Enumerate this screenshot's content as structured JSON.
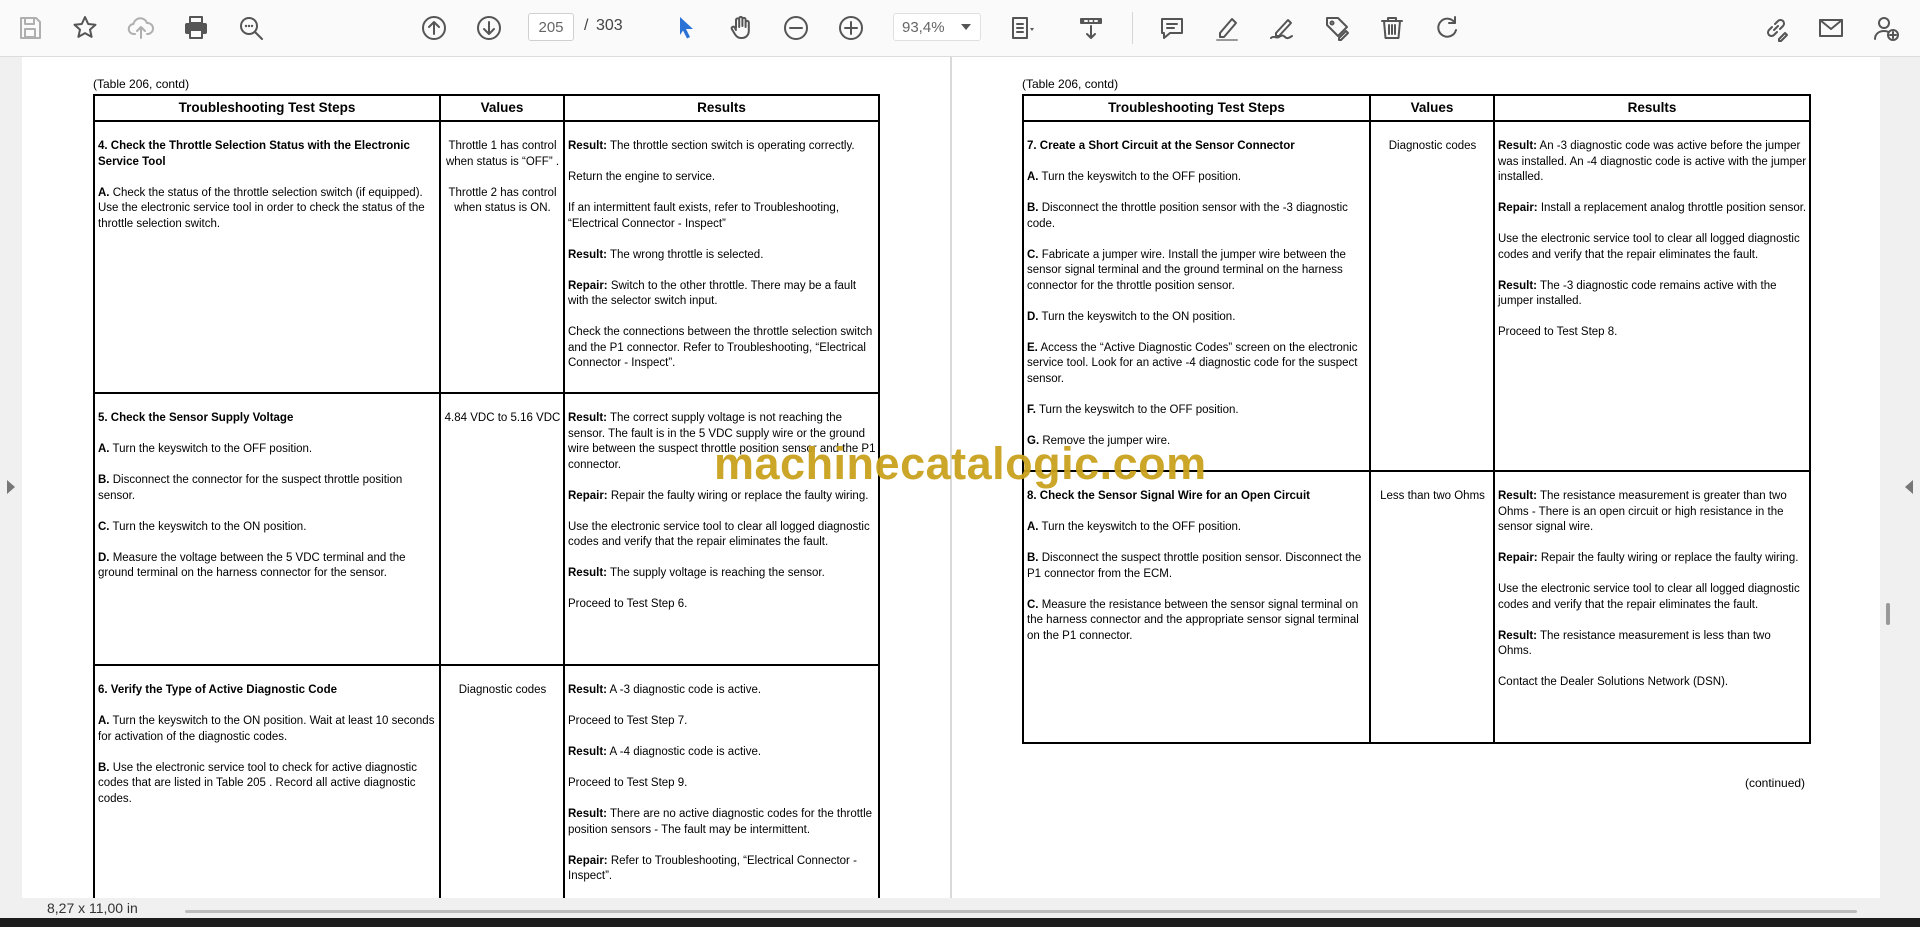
{
  "toolbar": {
    "current_page": "205",
    "page_separator": "/",
    "total_pages": "303",
    "zoom": "93,4%"
  },
  "left_page": {
    "caption": "(Table 206, contd)",
    "headers": [
      "Troubleshooting Test Steps",
      "Values",
      "Results"
    ],
    "rows": [
      {
        "title": "4. Check the Throttle Selection Status with the Electronic Service Tool",
        "steps": [
          {
            "letter": "A.",
            "text": "Check the status of the throttle selection switch (if equipped). Use the electronic service tool in order to check the status of the throttle selection switch."
          }
        ],
        "values": [
          "Throttle 1 has control when status is “OFF” .",
          "Throttle 2 has control when status is ON."
        ],
        "results": [
          {
            "label": "Result:",
            "text": "The throttle section switch is operating correctly."
          },
          {
            "label": "",
            "text": "Return the engine to service."
          },
          {
            "label": "",
            "text": "If an intermittent fault exists, refer to Troubleshooting, “Electrical Connector - Inspect”"
          },
          {
            "label": "Result:",
            "text": "The wrong throttle is selected."
          },
          {
            "label": "Repair:",
            "text": "Switch to the other throttle. There may be a fault with the selector switch input."
          },
          {
            "label": "",
            "text": "Check the connections between the throttle selection switch and the P1 connector. Refer to Troubleshooting, “Electrical Connector - Inspect”."
          }
        ]
      },
      {
        "title": "5. Check the Sensor Supply Voltage",
        "steps": [
          {
            "letter": "A.",
            "text": "Turn the keyswitch to the OFF position."
          },
          {
            "letter": "B.",
            "text": "Disconnect the connector for the suspect throttle position sensor."
          },
          {
            "letter": "C.",
            "text": "Turn the keyswitch to the ON position."
          },
          {
            "letter": "D.",
            "text": "Measure the voltage between the 5 VDC terminal and the ground terminal on the harness connector for the sensor."
          }
        ],
        "values": [
          "4.84 VDC to 5.16 VDC"
        ],
        "results": [
          {
            "label": "Result:",
            "text": "The correct supply voltage is not reaching the sensor. The fault is in the 5 VDC supply wire or the ground wire between the suspect throttle position sensor and the P1 connector."
          },
          {
            "label": "Repair:",
            "text": "Repair the faulty wiring or replace the faulty wiring."
          },
          {
            "label": "",
            "text": "Use the electronic service tool to clear all logged diagnostic codes and verify that the repair eliminates the fault."
          },
          {
            "label": "Result:",
            "text": "The supply voltage is reaching the sensor."
          },
          {
            "label": "",
            "text": "Proceed to Test Step 6."
          }
        ]
      },
      {
        "title": "6. Verify the Type of Active Diagnostic Code",
        "steps": [
          {
            "letter": "A.",
            "text": "Turn the keyswitch to the ON position. Wait at least 10 seconds for activation of the diagnostic codes."
          },
          {
            "letter": "B.",
            "text": "Use the electronic service tool to check for active diagnostic codes that are listed in Table 205 . Record all active diagnostic codes."
          }
        ],
        "values": [
          "Diagnostic codes"
        ],
        "results": [
          {
            "label": "Result:",
            "text": "A -3 diagnostic code is active."
          },
          {
            "label": "",
            "text": "Proceed to Test Step 7."
          },
          {
            "label": "Result:",
            "text": "A -4 diagnostic code is active."
          },
          {
            "label": "",
            "text": "Proceed to Test Step 9."
          },
          {
            "label": "Result:",
            "text": "There are no active diagnostic codes for the throttle position sensors - The fault may be intermittent."
          },
          {
            "label": "Repair:",
            "text": "Refer to Troubleshooting, “Electrical Connector - Inspect”."
          }
        ]
      }
    ]
  },
  "right_page": {
    "caption": "(Table 206, contd)",
    "headers": [
      "Troubleshooting Test Steps",
      "Values",
      "Results"
    ],
    "rows": [
      {
        "title": "7. Create a Short Circuit at the Sensor Connector",
        "steps": [
          {
            "letter": "A.",
            "text": "Turn the keyswitch to the OFF position."
          },
          {
            "letter": "B.",
            "text": "Disconnect the throttle position sensor with the -3 diagnostic code."
          },
          {
            "letter": "C.",
            "text": "Fabricate a jumper wire. Install the jumper wire between the sensor signal terminal and the ground terminal on the harness connector for the throttle position sensor."
          },
          {
            "letter": "D.",
            "text": "Turn the keyswitch to the ON position."
          },
          {
            "letter": "E.",
            "text": "Access the “Active Diagnostic Codes” screen on the electronic service tool. Look for an active -4 diagnostic code for the suspect sensor."
          },
          {
            "letter": "F.",
            "text": "Turn the keyswitch to the OFF position."
          },
          {
            "letter": "G.",
            "text": "Remove the jumper wire."
          }
        ],
        "values": [
          "Diagnostic codes"
        ],
        "results": [
          {
            "label": "Result:",
            "text": "An -3 diagnostic code was active before the jumper was installed. An -4 diagnostic code is active with the jumper installed."
          },
          {
            "label": "Repair:",
            "text": "Install a replacement analog throttle position sensor."
          },
          {
            "label": "",
            "text": "Use the electronic service tool to clear all logged diagnostic codes and verify that the repair eliminates the fault."
          },
          {
            "label": "Result:",
            "text": "The -3 diagnostic code remains active with the jumper installed."
          },
          {
            "label": "",
            "text": "Proceed to Test Step 8."
          }
        ]
      },
      {
        "title": "8. Check the Sensor Signal Wire for an Open Circuit",
        "steps": [
          {
            "letter": "A.",
            "text": "Turn the keyswitch to the OFF position."
          },
          {
            "letter": "B.",
            "text": "Disconnect the suspect throttle position sensor. Disconnect the P1 connector from the ECM."
          },
          {
            "letter": "C.",
            "text": "Measure the resistance between the sensor signal terminal on the harness connector and the appropriate sensor signal terminal on the P1 connector."
          }
        ],
        "values": [
          "Less than two Ohms"
        ],
        "results": [
          {
            "label": "Result:",
            "text": "The resistance measurement is greater than two Ohms - There is an open circuit or high resistance in the sensor signal wire."
          },
          {
            "label": "Repair:",
            "text": "Repair the faulty wiring or replace the faulty wiring."
          },
          {
            "label": "",
            "text": "Use the electronic service tool to clear all logged diagnostic codes and verify that the repair eliminates the fault."
          },
          {
            "label": "Result:",
            "text": "The resistance measurement is less than two Ohms."
          },
          {
            "label": "",
            "text": "Contact the Dealer Solutions Network (DSN)."
          }
        ]
      }
    ],
    "continued": "(continued)"
  },
  "watermark": "machinecatalogic.com",
  "status": {
    "page_size": "8,27 x 11,00 in"
  },
  "colors": {
    "accent": "#2a72d6",
    "watermark": "#c9a21e",
    "toolbar_bg": "#fafafa",
    "workspace_bg": "#f0f0f0"
  },
  "icons": [
    "save-icon",
    "bookmark-star-icon",
    "upload-cloud-icon",
    "print-icon",
    "zoom-search-icon",
    "page-up-icon",
    "page-down-icon",
    "select-cursor-icon",
    "hand-pan-icon",
    "zoom-out-icon",
    "zoom-in-icon",
    "fit-page-icon",
    "scroll-mode-icon",
    "comment-icon",
    "highlight-pen-icon",
    "sign-icon",
    "edit-tag-icon",
    "delete-icon",
    "rotate-icon",
    "link-edit-icon",
    "email-icon",
    "add-user-icon"
  ]
}
